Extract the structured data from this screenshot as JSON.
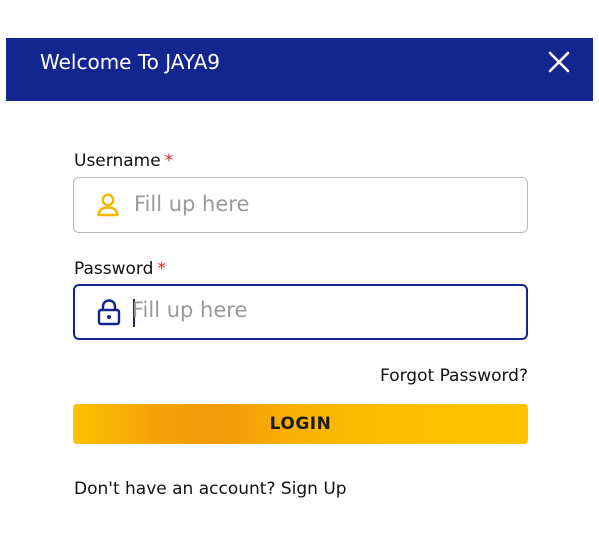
{
  "header": {
    "title": "Welcome To JAYA9",
    "close_icon": "close-icon"
  },
  "colors": {
    "header_bg": "#13258f",
    "required": "#e02424",
    "login_button": "#fdc000",
    "user_icon": "#f7b500",
    "lock_icon": "#13258f"
  },
  "username": {
    "label": "Username",
    "required_mark": "*",
    "placeholder": "Fill up here",
    "value": "",
    "icon": "user-icon"
  },
  "password": {
    "label": "Password",
    "required_mark": "*",
    "placeholder": "Fill up here",
    "value": "",
    "icon": "lock-icon"
  },
  "forgot_password": "Forgot Password?",
  "login_label": "LOGIN",
  "signup": {
    "prompt": "Don't have an account?",
    "link": "Sign Up"
  }
}
